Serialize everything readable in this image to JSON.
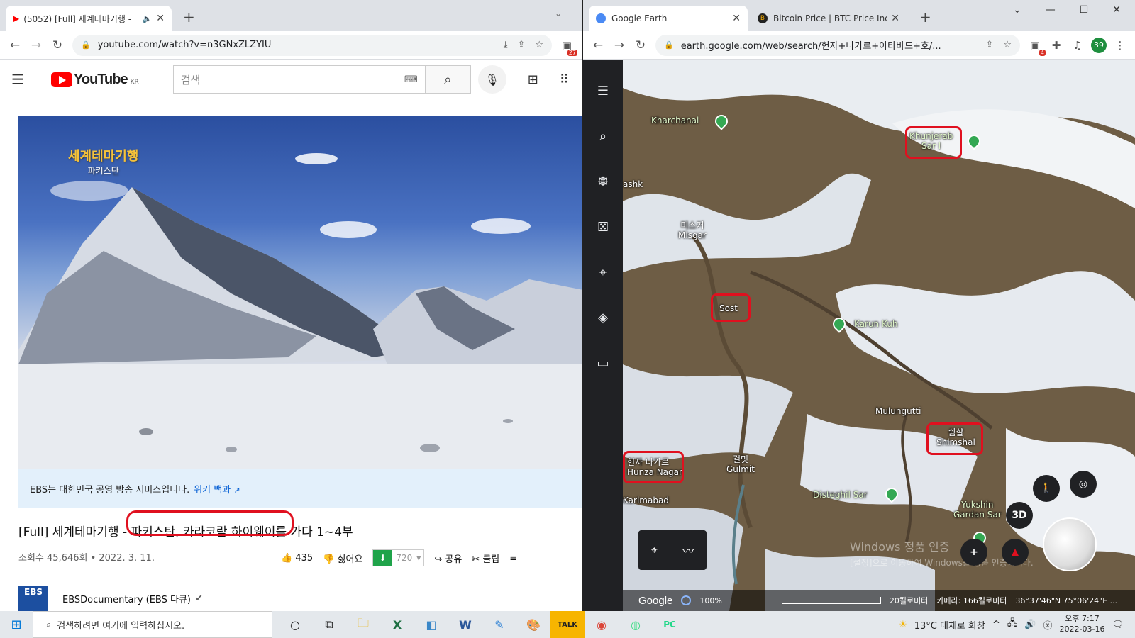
{
  "left_browser": {
    "tab_title": "(5052) [Full] 세계테마기행 -",
    "url": "youtube.com/watch?v=n3GNxZLZYIU",
    "ext_badge": "27"
  },
  "youtube": {
    "logo_text": "YouTube",
    "region": "KR",
    "search_placeholder": "검색",
    "video_overlay_title": "세계테마기행",
    "video_overlay_sub": "파키스탄",
    "info_bar_text": "EBS는 대한민국 공영 방송 서비스입니다.",
    "info_bar_link": "위키 백과",
    "title_prefix": "[Full] 세계테마기행 - ",
    "title_highlight": "파키스탄, 카라코람 하이웨이",
    "title_suffix": "를 가다 1~4부",
    "views": "조회수 45,646회 • 2022. 3. 11.",
    "likes": "435",
    "dislike_label": "싫어요",
    "quality": "720",
    "share_label": "공유",
    "clip_label": "클립",
    "channel_logo": "EBS",
    "channel_name": "EBSDocumentary (EBS 다큐)"
  },
  "right_browser": {
    "tab1_title": "Google Earth",
    "tab2_title": "Bitcoin Price | BTC Price Index a",
    "url": "earth.google.com/web/search/헌자+나가르+아타바드+호/...",
    "ext_badge": "4",
    "profile_badge": "39"
  },
  "earth": {
    "labels": {
      "kharchanai": "Kharchanai",
      "khunjerab": "Khunjerab\nSar I",
      "ashk": "ashk",
      "misgar": "미스거\nMisgar",
      "sost": "Sost",
      "karun_kuh": "Karun Kuh",
      "mulungutti": "Mulungutti",
      "shimshal": "쉼샬\nShimshal",
      "hunza": "헌자 나가르\nHunza Nagar",
      "gulmit": "걸밋\nGulmit",
      "karimabad": "Karimabad",
      "disteghil": "Disteghil Sar",
      "yukshin": "Yukshin\nGardan Sar"
    },
    "btn_3d": "3D",
    "google": "Google",
    "zoom": "100%",
    "scale": "20킬로미터",
    "camera": "카메라: 166킬로미터",
    "coords": "36°37'46\"N 75°06'24\"E ...",
    "watermark_line1": "Windows 정품 인증",
    "watermark_line2": "[설정]으로 이동하여 Windows를 정품 인증합니다."
  },
  "taskbar": {
    "search_placeholder": "검색하려면 여기에 입력하십시오.",
    "weather": "13°C 대체로 화창",
    "time": "오후 7:17",
    "date": "2022-03-16"
  },
  "colors": {
    "highlight_red": "#e0101f",
    "youtube_red": "#ff0000",
    "earth_dark": "#202124",
    "pin_green": "#34a853"
  }
}
